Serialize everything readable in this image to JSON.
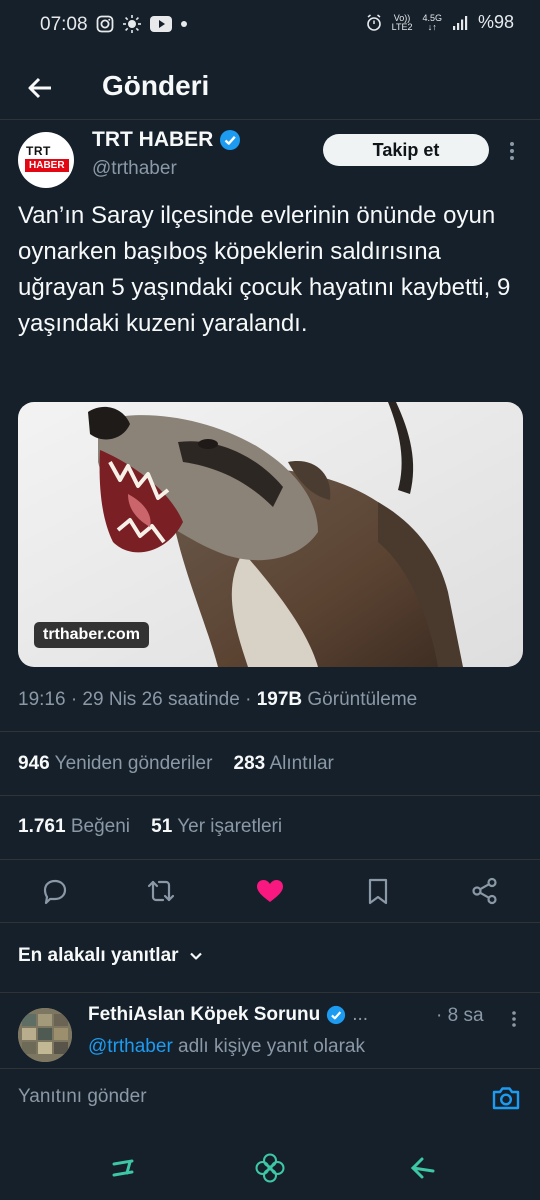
{
  "status_bar": {
    "time": "07:08",
    "net_top": "Vo))",
    "net_bottom": "LTE2",
    "net2_top": "4.5G",
    "net2_bottom": "↓↑",
    "battery": "%98"
  },
  "header": {
    "title": "Gönderi"
  },
  "author": {
    "logo_top": "TRT",
    "logo_bottom": "HABER",
    "name": "TRT HABER",
    "handle": "@trthaber",
    "follow_label": "Takip et"
  },
  "tweet": {
    "text": "Van’ın Saray ilçesinde evlerinin önünde oyun oynarken başıboş köpeklerin saldırısına uğrayan 5 yaşındaki çocuk hayatını kaybetti, 9 yaşındaki kuzeni yaralandı.",
    "media_source": "trthaber.com",
    "timestamp": "19:16 · 29 Nis 26 saatinde ·",
    "views_count": "197B",
    "views_label": "Görüntüleme"
  },
  "stats": {
    "reposts": "946",
    "reposts_label": "Yeniden gönderiler",
    "quotes": "283",
    "quotes_label": "Alıntılar",
    "likes": "1.761",
    "likes_label": "Beğeni",
    "bookmarks": "51",
    "bookmarks_label": "Yer işaretleri"
  },
  "actions": [
    "reply-icon",
    "retweet-icon",
    "like-icon",
    "bookmark-icon",
    "share-icon"
  ],
  "colors": {
    "like": "#f91880",
    "verified": "#1d9bf0",
    "background": "#15202b"
  },
  "replies": {
    "sort_label": "En alakalı yanıtlar",
    "items": [
      {
        "name": "FethiAslan Köpek Sorunu",
        "ellipsis": "...",
        "time": "· 8 sa",
        "reply_handle": "@trthaber",
        "reply_text": " adlı kişiye yanıt olarak"
      }
    ]
  },
  "composer": {
    "placeholder": "Yanıtını gönder"
  }
}
